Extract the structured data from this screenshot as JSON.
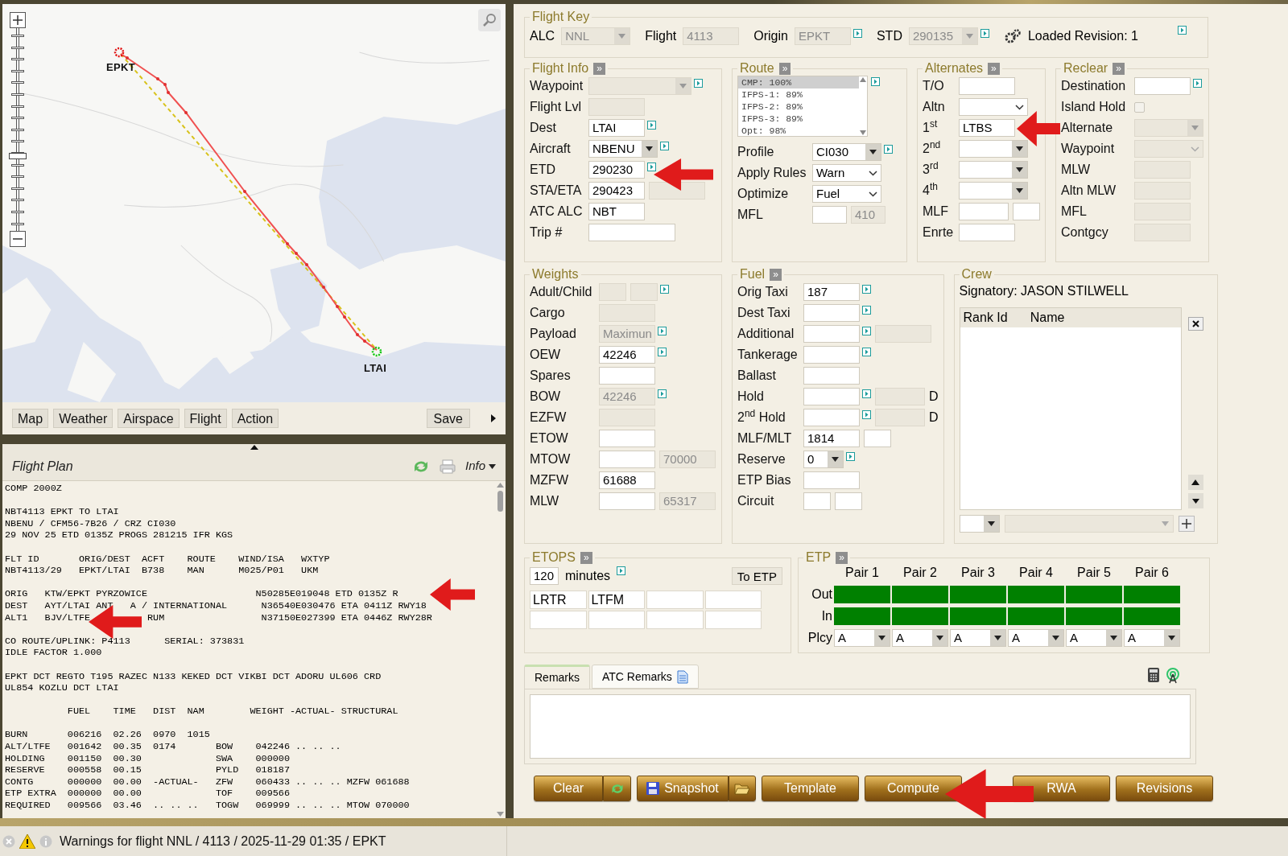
{
  "map": {
    "airports": [
      {
        "code": "EPKT",
        "kind": "origin"
      },
      {
        "code": "LTAI",
        "kind": "destination"
      }
    ],
    "zoom": {
      "level": 0.38
    },
    "toolbar": [
      "Map",
      "Weather",
      "Airspace",
      "Flight",
      "Action"
    ],
    "save": "Save"
  },
  "flight_plan": {
    "title": "Flight Plan",
    "menu": "Info",
    "blocks": [
      [
        "COMP 2000Z"
      ],
      [
        "NBT4113 EPKT TO LTAI",
        "NBENU / CFM56-7B26 / CRZ CI030",
        "29 NOV 25 ETD 0135Z PROGS 281215 IFR KGS"
      ],
      [
        "FLT ID       ORIG/DEST  ACFT    ROUTE    WIND/ISA   WXTYP",
        "NBT4113/29   EPKT/LTAI  B738    MAN      M025/P01   UKM"
      ],
      [
        "ORIG   KTW/EPKT PYRZOWICE                   N50285E019048 ETD 0135Z R",
        "DEST   AYT/LTAI ANT   A / INTERNATIONAL      N36540E030476 ETA 0411Z RWY18",
        "ALT1   BJV/LTFE          RUM                 N37150E027399 ETA 0446Z RWY28R"
      ],
      [
        "CO ROUTE/UPLINK: P4113      SERIAL: 373831",
        "IDLE FACTOR 1.000"
      ],
      [
        "EPKT DCT REGTO T195 RAZEC N133 KEKED DCT VIKBI DCT ADORU UL606 CRD",
        "UL854 KOZLU DCT LTAI"
      ],
      [
        "           FUEL    TIME   DIST  NAM        WEIGHT -ACTUAL- STRUCTURAL"
      ],
      [
        "BURN       006216  02.26  0970  1015",
        "ALT/LTFE   001642  00.35  0174       BOW    042246 .. .. ..",
        "HOLDING    001150  00.30             SWA    000000",
        "RESERVE    000558  00.15             PYLD   018187",
        "CONTG      000000  00.00  -ACTUAL-   ZFW    060433 .. .. .. MZFW 061688",
        "ETP EXTRA  000000  00.00             TOF    009566",
        "REQUIRED   009566  03.46  .. .. ..   TOGW   069999 .. .. .. MTOW 070000"
      ]
    ]
  },
  "flight_key": {
    "title": "Flight Key",
    "fields": [
      {
        "label": "ALC",
        "value": "NNL",
        "kind": "select",
        "disabled": true
      },
      {
        "label": "Flight",
        "value": "4113",
        "kind": "input",
        "disabled": true
      },
      {
        "label": "Origin",
        "value": "EPKT",
        "kind": "input",
        "disabled": true,
        "link": true
      },
      {
        "label": "STD",
        "value": "290135",
        "kind": "select",
        "disabled": true,
        "link": true
      }
    ],
    "revision": "Loaded Revision: 1",
    "revision_link": true
  },
  "flight_info": {
    "title": "Flight Info",
    "toggle": "»",
    "rows": [
      {
        "label": "Waypoint",
        "fields": [
          {
            "kind": "wideselect",
            "disabled": true,
            "link": true
          }
        ]
      },
      {
        "label": "Flight Lvl",
        "fields": [
          {
            "kind": "input",
            "disabled": true
          }
        ]
      },
      {
        "label": "Dest",
        "fields": [
          {
            "value": "LTAI",
            "kind": "input",
            "disabled": false,
            "link": true
          }
        ]
      },
      {
        "label": "Aircraft",
        "fields": [
          {
            "value": "NBENU",
            "kind": "select",
            "disabled": false,
            "link": true
          }
        ]
      },
      {
        "label": "ETD",
        "fields": [
          {
            "value": "290230",
            "kind": "input",
            "disabled": false,
            "link": true
          }
        ]
      },
      {
        "label": "STA/ETA",
        "fields": [
          {
            "value": "290423",
            "kind": "input",
            "disabled": false
          },
          {
            "kind": "input",
            "disabled": true
          }
        ]
      },
      {
        "label": "ATC ALC",
        "fields": [
          {
            "value": "NBT",
            "kind": "input",
            "disabled": false
          }
        ]
      },
      {
        "label": "Trip #",
        "fields": [
          {
            "kind": "wide",
            "disabled": false
          }
        ]
      }
    ]
  },
  "route": {
    "title": "Route",
    "toggle": "»",
    "options": [
      {
        "label": "CMP: 100%",
        "selected": true
      },
      {
        "label": "IFPS-1: 89%",
        "selected": false
      },
      {
        "label": "IFPS-2: 89%",
        "selected": false
      },
      {
        "label": "IFPS-3: 89%",
        "selected": false
      },
      {
        "label": "Opt: 98%",
        "selected": false
      }
    ],
    "options_link": true,
    "rows": [
      {
        "label": "Profile",
        "fields": [
          {
            "value": "CI030",
            "kind": "select",
            "disabled": false,
            "link": true
          }
        ]
      },
      {
        "label": "Apply Rules",
        "fields": [
          {
            "value": "Warn",
            "kind": "dropdown",
            "disabled": false
          }
        ]
      },
      {
        "label": "Optimize",
        "fields": [
          {
            "value": "Fuel",
            "kind": "dropdown",
            "disabled": false
          }
        ]
      },
      {
        "label": "MFL",
        "fields": [
          {
            "kind": "small",
            "disabled": false
          },
          {
            "value": "410",
            "kind": "small",
            "disabled": true
          }
        ]
      }
    ]
  },
  "alternates": {
    "title": "Alternates",
    "toggle": "»",
    "rows": [
      {
        "label": "T/O",
        "fields": [
          {
            "kind": "input",
            "disabled": false
          }
        ]
      },
      {
        "label": "Altn",
        "fields": [
          {
            "kind": "dropdown",
            "disabled": false
          }
        ]
      },
      {
        "label": "1$^{st}$",
        "fields": [
          {
            "value": "LTBS",
            "kind": "input",
            "disabled": false
          }
        ]
      },
      {
        "label": "2$^{nd}$",
        "fields": [
          {
            "kind": "select",
            "disabled": false
          }
        ]
      },
      {
        "label": "3$^{rd}$",
        "fields": [
          {
            "kind": "select",
            "disabled": false
          }
        ]
      },
      {
        "label": "4$^{th}$",
        "fields": [
          {
            "kind": "select",
            "disabled": false
          }
        ]
      },
      {
        "label": "MLF",
        "fields": [
          {
            "kind": "medium",
            "disabled": false
          },
          {
            "kind": "tiny",
            "disabled": false
          }
        ]
      },
      {
        "label": "Enrte",
        "fields": [
          {
            "kind": "input",
            "disabled": false
          }
        ]
      }
    ]
  },
  "reclear": {
    "title": "Reclear",
    "toggle": "»",
    "rows": [
      {
        "label": "Destination",
        "fields": [
          {
            "kind": "input",
            "disabled": false,
            "link": true
          }
        ]
      },
      {
        "label": "Island Hold",
        "fields": [
          {
            "kind": "checkbox",
            "checked": false,
            "disabled": true
          }
        ]
      },
      {
        "label": "Alternate",
        "fields": [
          {
            "kind": "select",
            "disabled": true
          }
        ]
      },
      {
        "label": "Waypoint",
        "fields": [
          {
            "kind": "dropdown",
            "disabled": true
          }
        ]
      },
      {
        "label": "MLW",
        "fields": [
          {
            "kind": "input",
            "disabled": true
          }
        ]
      },
      {
        "label": "Altn MLW",
        "fields": [
          {
            "kind": "input",
            "disabled": true
          }
        ]
      },
      {
        "label": "MFL",
        "fields": [
          {
            "kind": "input",
            "disabled": true
          }
        ]
      },
      {
        "label": "Contgcy",
        "fields": [
          {
            "kind": "input",
            "disabled": true
          }
        ]
      }
    ]
  },
  "weights": {
    "title": "Weights",
    "rows": [
      {
        "label": "Adult/Child",
        "fields": [
          {
            "kind": "tiny",
            "disabled": true
          },
          {
            "kind": "tiny",
            "disabled": true,
            "link": true
          }
        ]
      },
      {
        "label": "Cargo",
        "fields": [
          {
            "kind": "input",
            "disabled": true
          }
        ]
      },
      {
        "label": "Payload",
        "fields": [
          {
            "value": "Maximun",
            "kind": "input",
            "disabled": true,
            "link": true
          }
        ]
      },
      {
        "label": "OEW",
        "fields": [
          {
            "value": "42246",
            "kind": "input",
            "disabled": false,
            "link": true
          }
        ]
      },
      {
        "label": "Spares",
        "fields": [
          {
            "kind": "input",
            "disabled": false
          }
        ]
      },
      {
        "label": "BOW",
        "fields": [
          {
            "value": "42246",
            "kind": "input",
            "disabled": true,
            "link": true
          }
        ]
      },
      {
        "label": "EZFW",
        "fields": [
          {
            "kind": "input",
            "disabled": true
          }
        ]
      },
      {
        "label": "ETOW",
        "fields": [
          {
            "kind": "input",
            "disabled": false
          }
        ]
      },
      {
        "label": "MTOW",
        "fields": [
          {
            "kind": "input",
            "disabled": false
          },
          {
            "value": "70000",
            "kind": "input",
            "disabled": true
          }
        ]
      },
      {
        "label": "MZFW",
        "fields": [
          {
            "value": "61688",
            "kind": "input",
            "disabled": false
          }
        ]
      },
      {
        "label": "MLW",
        "fields": [
          {
            "kind": "input",
            "disabled": false
          },
          {
            "value": "65317",
            "kind": "input",
            "disabled": true
          }
        ]
      }
    ]
  },
  "fuel": {
    "title": "Fuel",
    "toggle": "»",
    "rows": [
      {
        "label": "Orig Taxi",
        "fields": [
          {
            "value": "187",
            "kind": "input",
            "disabled": false,
            "link": true
          }
        ]
      },
      {
        "label": "Dest Taxi",
        "fields": [
          {
            "kind": "input",
            "disabled": false,
            "link": true
          }
        ]
      },
      {
        "label": "Additional",
        "fields": [
          {
            "kind": "input",
            "disabled": false,
            "link": true
          },
          {
            "kind": "input",
            "disabled": true
          }
        ]
      },
      {
        "label": "Tankerage",
        "fields": [
          {
            "kind": "input",
            "disabled": false,
            "link": true
          }
        ]
      },
      {
        "label": "Ballast",
        "fields": [
          {
            "kind": "input",
            "disabled": false
          }
        ]
      },
      {
        "label": "Hold",
        "fields": [
          {
            "kind": "input",
            "disabled": false,
            "link": true
          },
          {
            "kind": "medium",
            "disabled": true
          }
        ],
        "suffix": "D"
      },
      {
        "label": "2$^{nd}$ Hold",
        "fields": [
          {
            "kind": "input",
            "disabled": false,
            "link": true
          },
          {
            "kind": "medium",
            "disabled": true
          }
        ],
        "suffix": "D"
      },
      {
        "label": "MLF/MLT",
        "fields": [
          {
            "value": "1814",
            "kind": "input",
            "disabled": false
          },
          {
            "kind": "tiny",
            "disabled": false
          }
        ]
      },
      {
        "label": "Reserve",
        "fields": [
          {
            "value": "0",
            "kind": "smallselect",
            "disabled": false,
            "link": true
          }
        ]
      },
      {
        "label": "ETP Bias",
        "fields": [
          {
            "kind": "input",
            "disabled": false
          }
        ]
      },
      {
        "label": "Circuit",
        "fields": [
          {
            "kind": "tiny",
            "disabled": false
          },
          {
            "kind": "tiny",
            "disabled": false
          }
        ]
      }
    ]
  },
  "crew": {
    "title": "Crew",
    "signatory": "Signatory: JASON STILWELL",
    "columns": [
      "Rank Id",
      "Name"
    ]
  },
  "etops": {
    "title": "ETOPS",
    "toggle": "»",
    "minutes_value": "120",
    "minutes_label": "minutes",
    "link": true,
    "button": "To ETP",
    "airports": [
      {
        "value": "LRTR",
        "kind": "input"
      },
      {
        "value": "LTFM",
        "kind": "input"
      },
      {
        "kind": "input"
      },
      {
        "kind": "input"
      },
      {
        "kind": "input"
      },
      {
        "kind": "input"
      },
      {
        "kind": "input"
      },
      {
        "kind": "input"
      }
    ]
  },
  "etp": {
    "title": "ETP",
    "toggle": "»",
    "row_labels": [
      "Out",
      "In",
      "Plcy"
    ],
    "pairs": [
      {
        "label": "Pair 1",
        "out_ok": true,
        "in_ok": true,
        "policy": "A"
      },
      {
        "label": "Pair 2",
        "out_ok": true,
        "in_ok": true,
        "policy": "A"
      },
      {
        "label": "Pair 3",
        "out_ok": true,
        "in_ok": true,
        "policy": "A"
      },
      {
        "label": "Pair 4",
        "out_ok": true,
        "in_ok": true,
        "policy": "A"
      },
      {
        "label": "Pair 5",
        "out_ok": true,
        "in_ok": true,
        "policy": "A"
      },
      {
        "label": "Pair 6",
        "out_ok": true,
        "in_ok": true,
        "policy": "A"
      }
    ]
  },
  "remarks_tabs": [
    {
      "label": "Remarks",
      "selected": true
    },
    {
      "label": "ATC Remarks",
      "selected": false
    }
  ],
  "buttons": [
    {
      "label": "Clear",
      "kind": "refresh"
    },
    {
      "label": "Snapshot",
      "kind": "snapshot"
    },
    {
      "label": "Template",
      "kind": "plain"
    },
    {
      "label": "Compute",
      "kind": "plain"
    },
    {
      "label": "RWA",
      "kind": "spaced"
    },
    {
      "label": "Revisions",
      "kind": "plain"
    }
  ],
  "status_bar": {
    "message": "Warnings for flight NNL / 4113 / 2025-11-29 01:35 / EPKT"
  }
}
